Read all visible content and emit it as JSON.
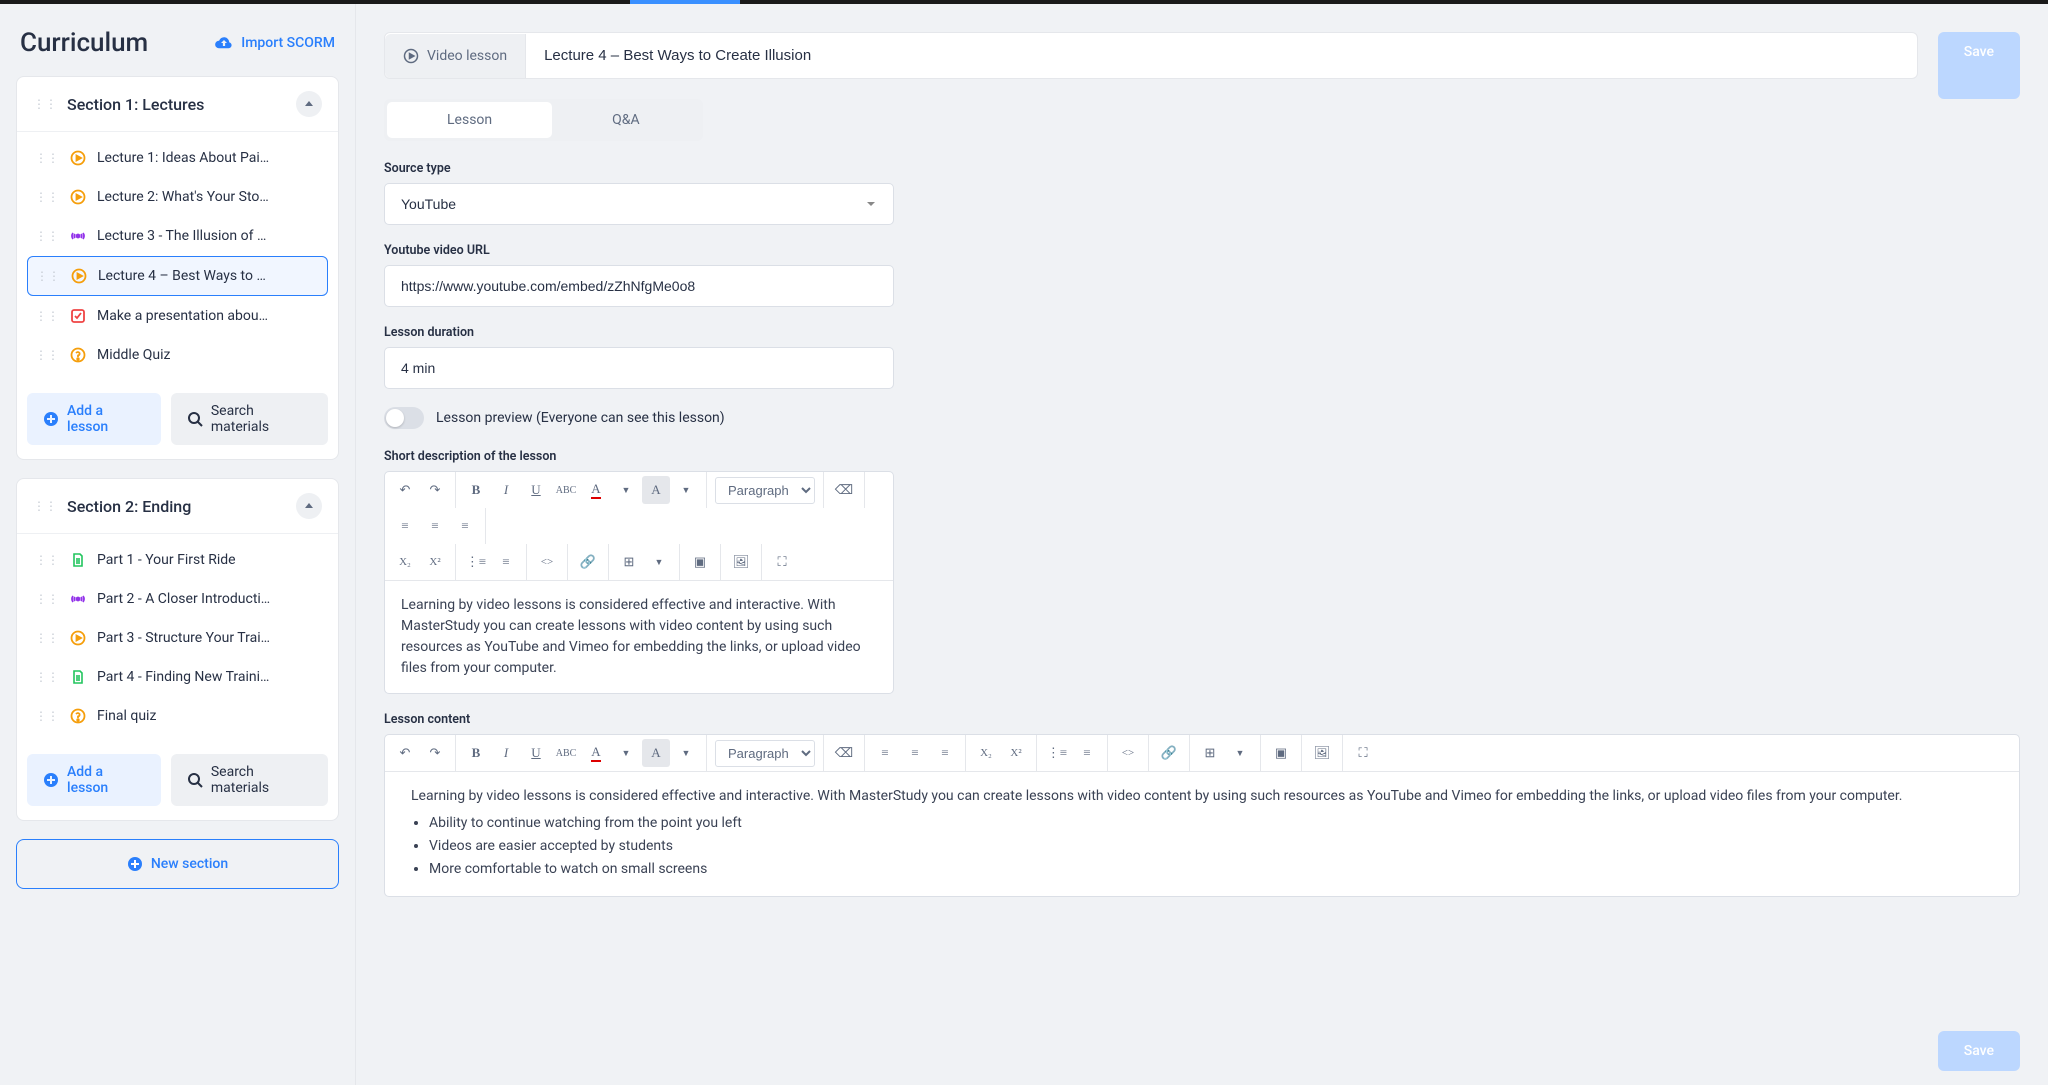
{
  "sidebar": {
    "title": "Curriculum",
    "import_label": "Import SCORM",
    "section1": {
      "title": "Section 1: Lectures",
      "items": [
        {
          "label": "Lecture 1: Ideas About Pai…",
          "icon": "play",
          "icon_color": "#f59e0b"
        },
        {
          "label": "Lecture 2: What's Your Sto…",
          "icon": "play",
          "icon_color": "#f59e0b"
        },
        {
          "label": "Lecture 3 - The Illusion of …",
          "icon": "stream",
          "icon_color": "#9333ea"
        },
        {
          "label": "Lecture 4 – Best Ways to …",
          "icon": "play",
          "icon_color": "#f59e0b"
        },
        {
          "label": "Make a presentation abou…",
          "icon": "check",
          "icon_color": "#ef4444"
        },
        {
          "label": "Middle Quiz",
          "icon": "quiz",
          "icon_color": "#f59e0b"
        }
      ],
      "add_lesson": "Add a lesson",
      "search_materials": "Search materials"
    },
    "section2": {
      "title": "Section 2: Ending",
      "items": [
        {
          "label": "Part 1 - Your First Ride",
          "icon": "doc",
          "icon_color": "#22c55e"
        },
        {
          "label": "Part 2 - A Closer Introducti…",
          "icon": "stream",
          "icon_color": "#9333ea"
        },
        {
          "label": "Part 3 - Structure Your Trai…",
          "icon": "play",
          "icon_color": "#f59e0b"
        },
        {
          "label": "Part 4 - Finding New Traini…",
          "icon": "doc",
          "icon_color": "#22c55e"
        },
        {
          "label": "Final quiz",
          "icon": "quiz",
          "icon_color": "#f59e0b"
        }
      ],
      "add_lesson": "Add a lesson",
      "search_materials": "Search materials"
    },
    "new_section": "New section"
  },
  "main": {
    "badge": "Video lesson",
    "title": "Lecture 4 – Best Ways to Create Illusion",
    "save": "Save",
    "tabs": {
      "lesson": "Lesson",
      "qa": "Q&A"
    },
    "source_type_label": "Source type",
    "source_type_value": "YouTube",
    "url_label": "Youtube video URL",
    "url_value": "https://www.youtube.com/embed/zZhNfgMe0o8",
    "duration_label": "Lesson duration",
    "duration_value": "4 min",
    "preview_label": "Lesson preview (Everyone can see this lesson)",
    "short_desc_label": "Short description of the lesson",
    "short_desc_body": "Learning by video lessons is considered effective and interactive. With MasterStudy you can create lessons with video content by using such resources as YouTube and Vimeo for embedding the links, or upload video files from your computer.",
    "content_label": "Lesson content",
    "content_intro": "Learning by video lessons is considered effective and interactive. With MasterStudy you can create lessons with video content by using such resources as YouTube and Vimeo for embedding the links, or upload video files from your computer.",
    "content_bullets": [
      "Ability to continue watching from the point you left",
      "Videos are easier accepted by students",
      "More comfortable to watch on small screens"
    ],
    "paragraph_label": "Paragraph"
  }
}
